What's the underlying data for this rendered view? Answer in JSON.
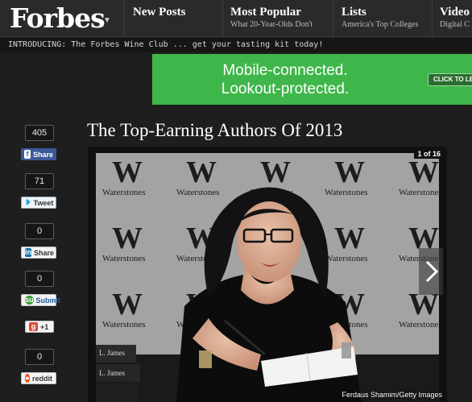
{
  "header": {
    "logo": "Forbes",
    "nav": [
      {
        "title": "New Posts",
        "subtitle": ""
      },
      {
        "title": "Most Popular",
        "subtitle": "What 20-Year-Olds Don't"
      },
      {
        "title": "Lists",
        "subtitle": "America's Top Colleges"
      },
      {
        "title": "Video",
        "subtitle": "Digital C"
      }
    ]
  },
  "ticker": "INTRODUCING: The Forbes Wine Club ... get your tasting kit today!",
  "ad": {
    "line1": "Mobile-connected.",
    "line2": "Lookout-protected.",
    "cta": "CLICK TO LEARN MORE",
    "color": "#3fb64a"
  },
  "share": [
    {
      "count": "405",
      "label": "Share",
      "icon": "f",
      "network": "facebook"
    },
    {
      "count": "71",
      "label": "Tweet",
      "icon": "twitter-bird-icon",
      "network": "twitter"
    },
    {
      "count": "0",
      "label": "Share",
      "icon": "in",
      "network": "linkedin"
    },
    {
      "count": "0",
      "label": "Submit",
      "icon": "su",
      "network": "stumbleupon"
    },
    {
      "count": "",
      "label": "+1",
      "icon": "g",
      "network": "google-plus"
    },
    {
      "count": "0",
      "label": "reddit",
      "icon": "reddit-alien-icon",
      "network": "reddit"
    }
  ],
  "article": {
    "title": "The Top-Earning Authors Of 2013"
  },
  "slideshow": {
    "pager": "1 of 16",
    "credit": "Ferdaus Shamim/Getty Images",
    "banner_mark": "W",
    "banner_word": "Waterstones",
    "book_spine": "L. James"
  }
}
